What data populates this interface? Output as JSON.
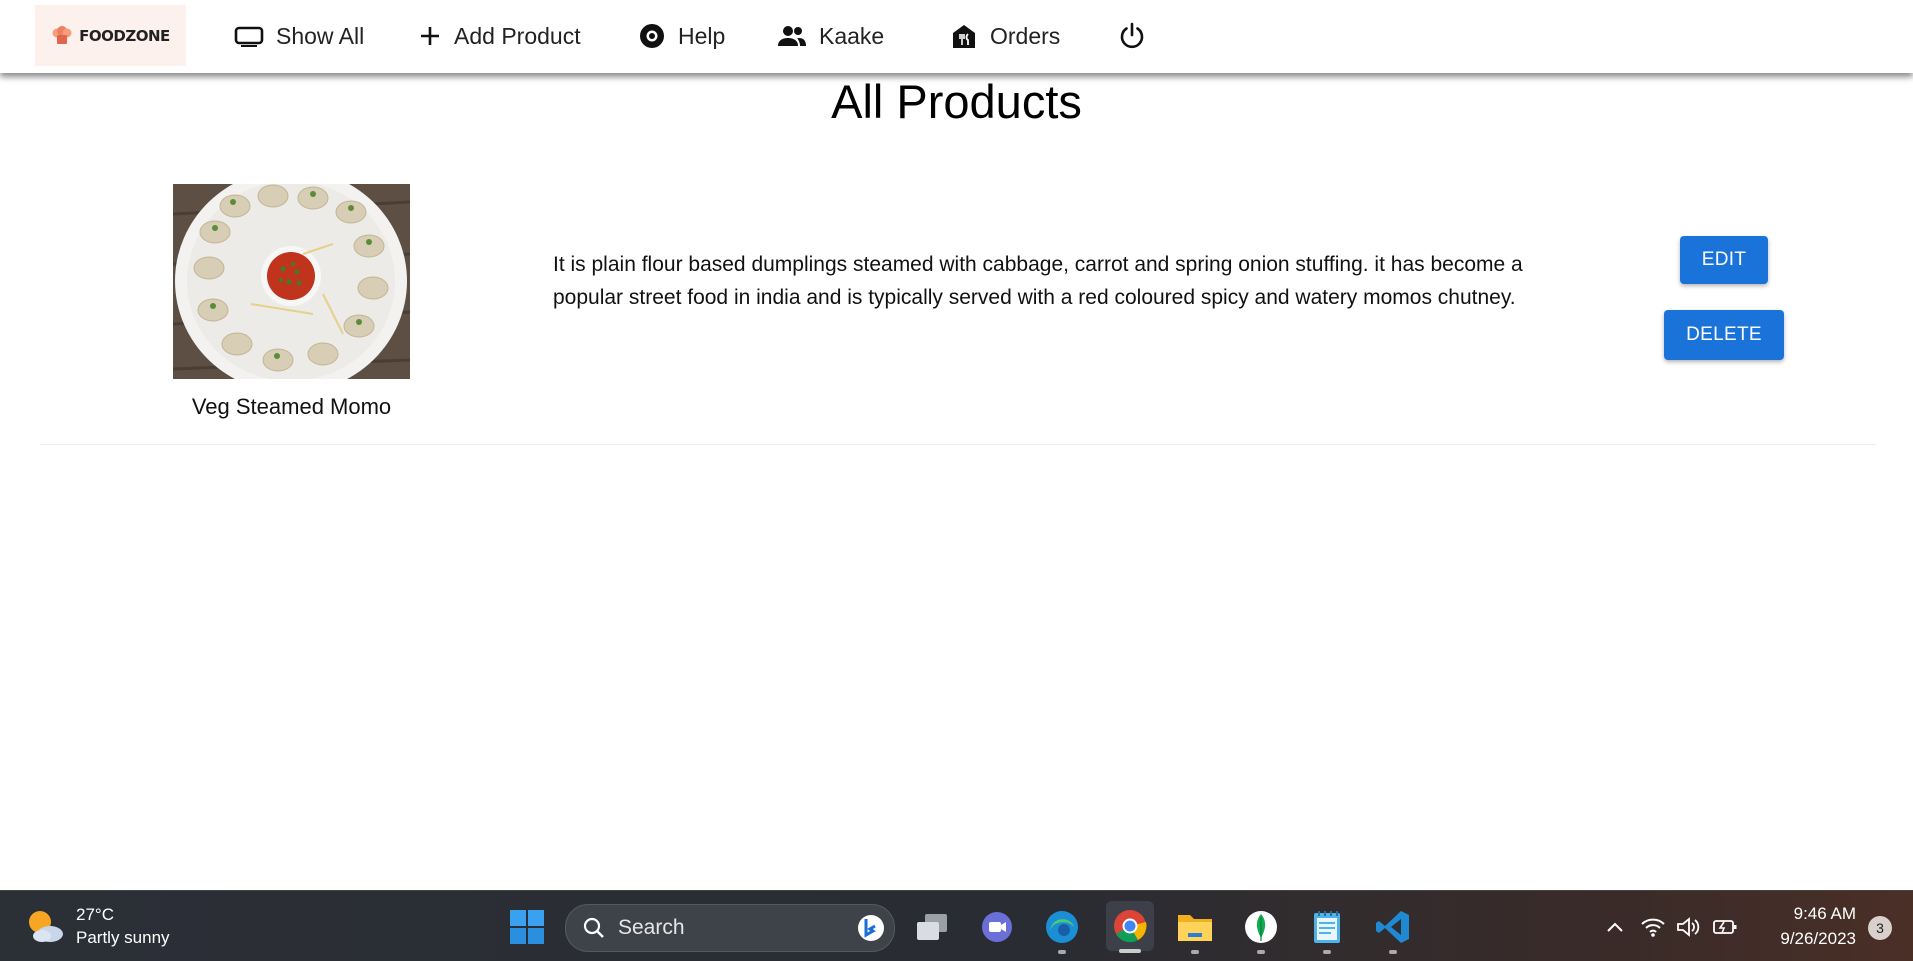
{
  "navbar": {
    "logo_text": "FOODZONE",
    "items": [
      {
        "label": "Show All",
        "icon": "display-icon"
      },
      {
        "label": "Add Product",
        "icon": "plus-icon"
      },
      {
        "label": "Help",
        "icon": "help-icon"
      },
      {
        "label": "Kaake",
        "icon": "people-icon"
      },
      {
        "label": "Orders",
        "icon": "restaurant-icon"
      }
    ],
    "power_icon": "power-icon"
  },
  "main": {
    "title": "All Products",
    "products": [
      {
        "name": "Veg Steamed Momo",
        "description": "It is plain flour based dumplings steamed with cabbage, carrot and spring onion stuffing. it has become a popular street food in india and is typically served with a red coloured spicy and watery momos chutney.",
        "edit_label": "EDIT",
        "delete_label": "DELETE"
      }
    ]
  },
  "taskbar": {
    "weather_temp": "27°C",
    "weather_desc": "Partly sunny",
    "search_placeholder": "Search",
    "time": "9:46 AM",
    "date": "9/26/2023",
    "notification_count": "3"
  },
  "colors": {
    "accent": "#1a73d9",
    "logo_bg": "#fdf1ee"
  }
}
